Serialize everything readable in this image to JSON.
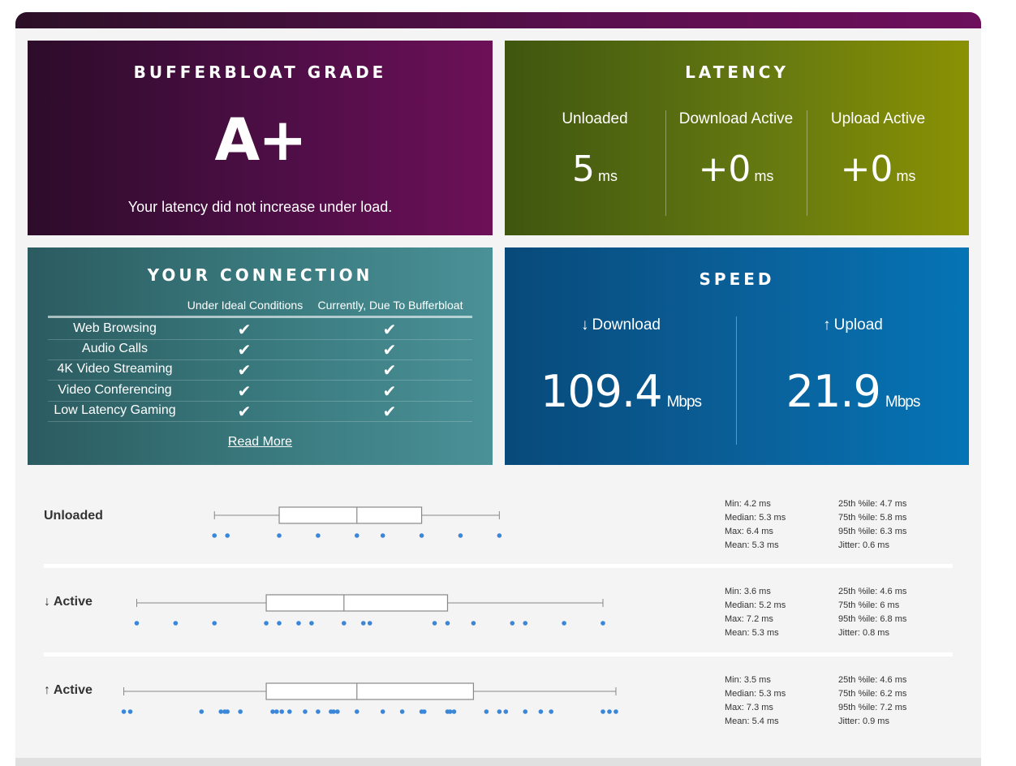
{
  "grade": {
    "title": "BUFFERBLOAT GRADE",
    "value": "A+",
    "message": "Your latency did not increase under load."
  },
  "latency": {
    "title": "LATENCY",
    "columns": [
      {
        "label": "Unloaded",
        "value": "5",
        "unit": "ms"
      },
      {
        "label": "Download Active",
        "value": "+0",
        "unit": "ms"
      },
      {
        "label": "Upload Active",
        "value": "+0",
        "unit": "ms"
      }
    ]
  },
  "connection": {
    "title": "YOUR CONNECTION",
    "col_ideal": "Under Ideal Conditions",
    "col_current": "Currently, Due To Bufferbloat",
    "rows": [
      {
        "name": "Web Browsing",
        "ideal": "✔",
        "current": "✔"
      },
      {
        "name": "Audio Calls",
        "ideal": "✔",
        "current": "✔"
      },
      {
        "name": "4K Video Streaming",
        "ideal": "✔",
        "current": "✔"
      },
      {
        "name": "Video Conferencing",
        "ideal": "✔",
        "current": "✔"
      },
      {
        "name": "Low Latency Gaming",
        "ideal": "✔",
        "current": "✔"
      }
    ],
    "read_more": "Read More"
  },
  "speed": {
    "title": "SPEED",
    "download": {
      "arrow": "↓",
      "label": "Download",
      "value": "109.4",
      "unit": "Mbps"
    },
    "upload": {
      "arrow": "↑",
      "label": "Upload",
      "value": "21.9",
      "unit": "Mbps"
    }
  },
  "plots": [
    {
      "label": "Unloaded",
      "stats_left": [
        "Min: 4.2 ms",
        "Median: 5.3 ms",
        "Max: 6.4 ms",
        "Mean: 5.3 ms"
      ],
      "stats_right": [
        "25th %ile: 4.7 ms",
        "75th %ile: 5.8 ms",
        "95th %ile: 6.3 ms",
        "Jitter: 0.6 ms"
      ],
      "box": {
        "min": 4.2,
        "q1": 4.7,
        "median": 5.3,
        "q3": 5.8,
        "max": 6.4
      },
      "points": [
        4.2,
        4.3,
        4.7,
        5.0,
        5.3,
        5.5,
        5.8,
        6.1,
        6.4
      ]
    },
    {
      "label": "↓ Active",
      "stats_left": [
        "Min: 3.6 ms",
        "Median: 5.2 ms",
        "Max: 7.2 ms",
        "Mean: 5.3 ms"
      ],
      "stats_right": [
        "25th %ile: 4.6 ms",
        "75th %ile: 6 ms",
        "95th %ile: 6.8 ms",
        "Jitter: 0.8 ms"
      ],
      "box": {
        "min": 3.6,
        "q1": 4.6,
        "median": 5.2,
        "q3": 6.0,
        "max": 7.2
      },
      "points": [
        3.6,
        3.9,
        4.2,
        4.6,
        4.7,
        4.85,
        4.95,
        5.2,
        5.35,
        5.4,
        5.9,
        6.0,
        6.2,
        6.5,
        6.6,
        6.9,
        7.2
      ]
    },
    {
      "label": "↑ Active",
      "stats_left": [
        "Min: 3.5 ms",
        "Median: 5.3 ms",
        "Max: 7.3 ms",
        "Mean: 5.4 ms"
      ],
      "stats_right": [
        "25th %ile: 4.6 ms",
        "75th %ile: 6.2 ms",
        "95th %ile: 7.2 ms",
        "Jitter: 0.9 ms"
      ],
      "box": {
        "min": 3.5,
        "q1": 4.6,
        "median": 5.3,
        "q3": 6.2,
        "max": 7.3
      },
      "points": [
        3.5,
        3.55,
        4.1,
        4.25,
        4.28,
        4.3,
        4.4,
        4.65,
        4.68,
        4.72,
        4.78,
        4.9,
        5.0,
        5.1,
        5.12,
        5.15,
        5.3,
        5.5,
        5.65,
        5.8,
        5.82,
        6.0,
        6.02,
        6.05,
        6.3,
        6.4,
        6.45,
        6.6,
        6.72,
        6.8,
        7.2,
        7.25,
        7.3
      ]
    }
  ]
}
